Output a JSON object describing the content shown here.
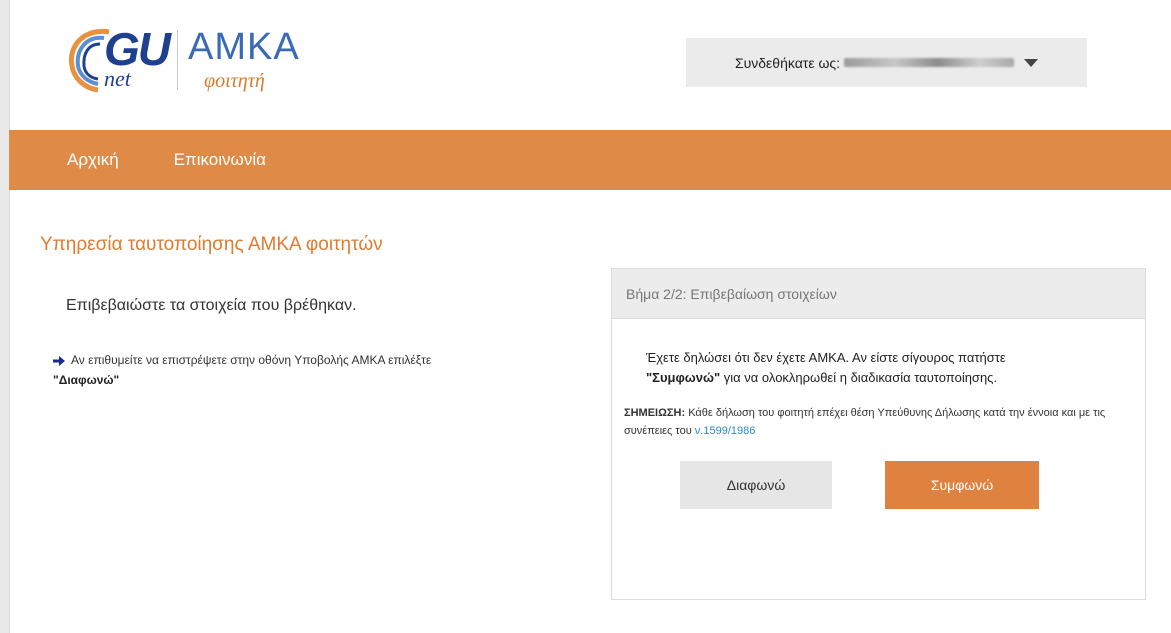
{
  "header": {
    "logo": {
      "brand": "GU",
      "brand_sub": "net",
      "title": "ΑΜΚΑ",
      "subtitle": "φοιτητή"
    },
    "user_prefix": "Συνδεθήκατε ως:"
  },
  "nav": {
    "items": [
      {
        "label": "Αρχική"
      },
      {
        "label": "Επικοινωνία"
      }
    ]
  },
  "main": {
    "title": "Υπηρεσία ταυτοποίησης ΑΜΚΑ φοιτητών",
    "confirm_text": "Επιβεβαιώστε τα στοιχεία που βρέθηκαν.",
    "hint_text": "Αν επιθυμείτε να επιστρέψετε στην οθόνη Υποβολής ΑΜΚΑ επιλέξτε",
    "hint_bold": "\"Διαφωνώ\""
  },
  "panel": {
    "heading": "Βήμα 2/2: Επιβεβαίωση στοιχείων",
    "line1": "Έχετε δηλώσει ότι δεν έχετε ΑΜΚΑ. Αν είστε σίγουρος πατήστε",
    "line2_bold": "\"Συμφωνώ\"",
    "line2_rest": "για να ολοκληρωθεί η διαδικασία ταυτοποίησης.",
    "note_label": "ΣΗΜΕΙΩΣΗ:",
    "note_text": "Κάθε δήλωση του φοιτητή επέχει θέση Υπεύθυνης Δήλωσης κατά την έννοια και με τις συνέπειες του",
    "note_link": "ν.1599/1986",
    "disagree_label": "Διαφωνώ",
    "agree_label": "Συμφωνώ"
  },
  "colors": {
    "accent": "#e08a47",
    "title": "#e07b2f",
    "link": "#2b8ac9",
    "logo_blue": "#1f3f8f"
  }
}
